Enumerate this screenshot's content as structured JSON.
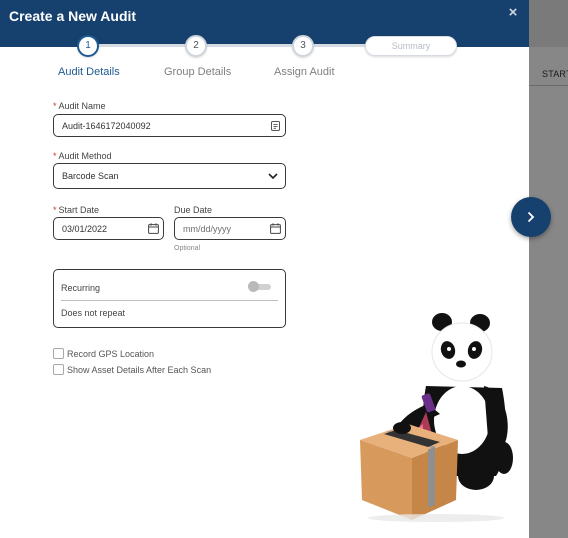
{
  "background": {
    "column_header": "START"
  },
  "modal": {
    "title": "Create a New Audit",
    "close_glyph": "×"
  },
  "stepper": {
    "steps": [
      {
        "number": "1",
        "label": "Audit Details",
        "active": true
      },
      {
        "number": "2",
        "label": "Group Details",
        "active": false
      },
      {
        "number": "3",
        "label": "Assign Audit",
        "active": false
      }
    ],
    "summary_label": "Summary"
  },
  "form": {
    "audit_name": {
      "label": "Audit Name",
      "required_mark": "*",
      "value": "Audit-1646172040092",
      "icon": "id-card-icon"
    },
    "audit_method": {
      "label": "Audit Method",
      "required_mark": "*",
      "value": "Barcode Scan",
      "icon": "chevron-down-icon"
    },
    "start_date": {
      "label": "Start Date",
      "required_mark": "*",
      "value": "03/01/2022",
      "icon": "calendar-icon"
    },
    "due_date": {
      "label": "Due Date",
      "placeholder": "mm/dd/yyyy",
      "hint": "Optional",
      "icon": "calendar-icon"
    },
    "recurring": {
      "label": "Recurring",
      "enabled": false,
      "value": "Does not repeat"
    },
    "checkboxes": [
      {
        "label": "Record GPS Location",
        "checked": false
      },
      {
        "label": "Show Asset Details After Each Scan",
        "checked": false
      }
    ]
  },
  "next_button": {
    "icon": "chevron-right-icon"
  },
  "colors": {
    "header_navy": "#16416e",
    "accent_blue": "#1f5a91",
    "required_red": "#d0312d"
  }
}
